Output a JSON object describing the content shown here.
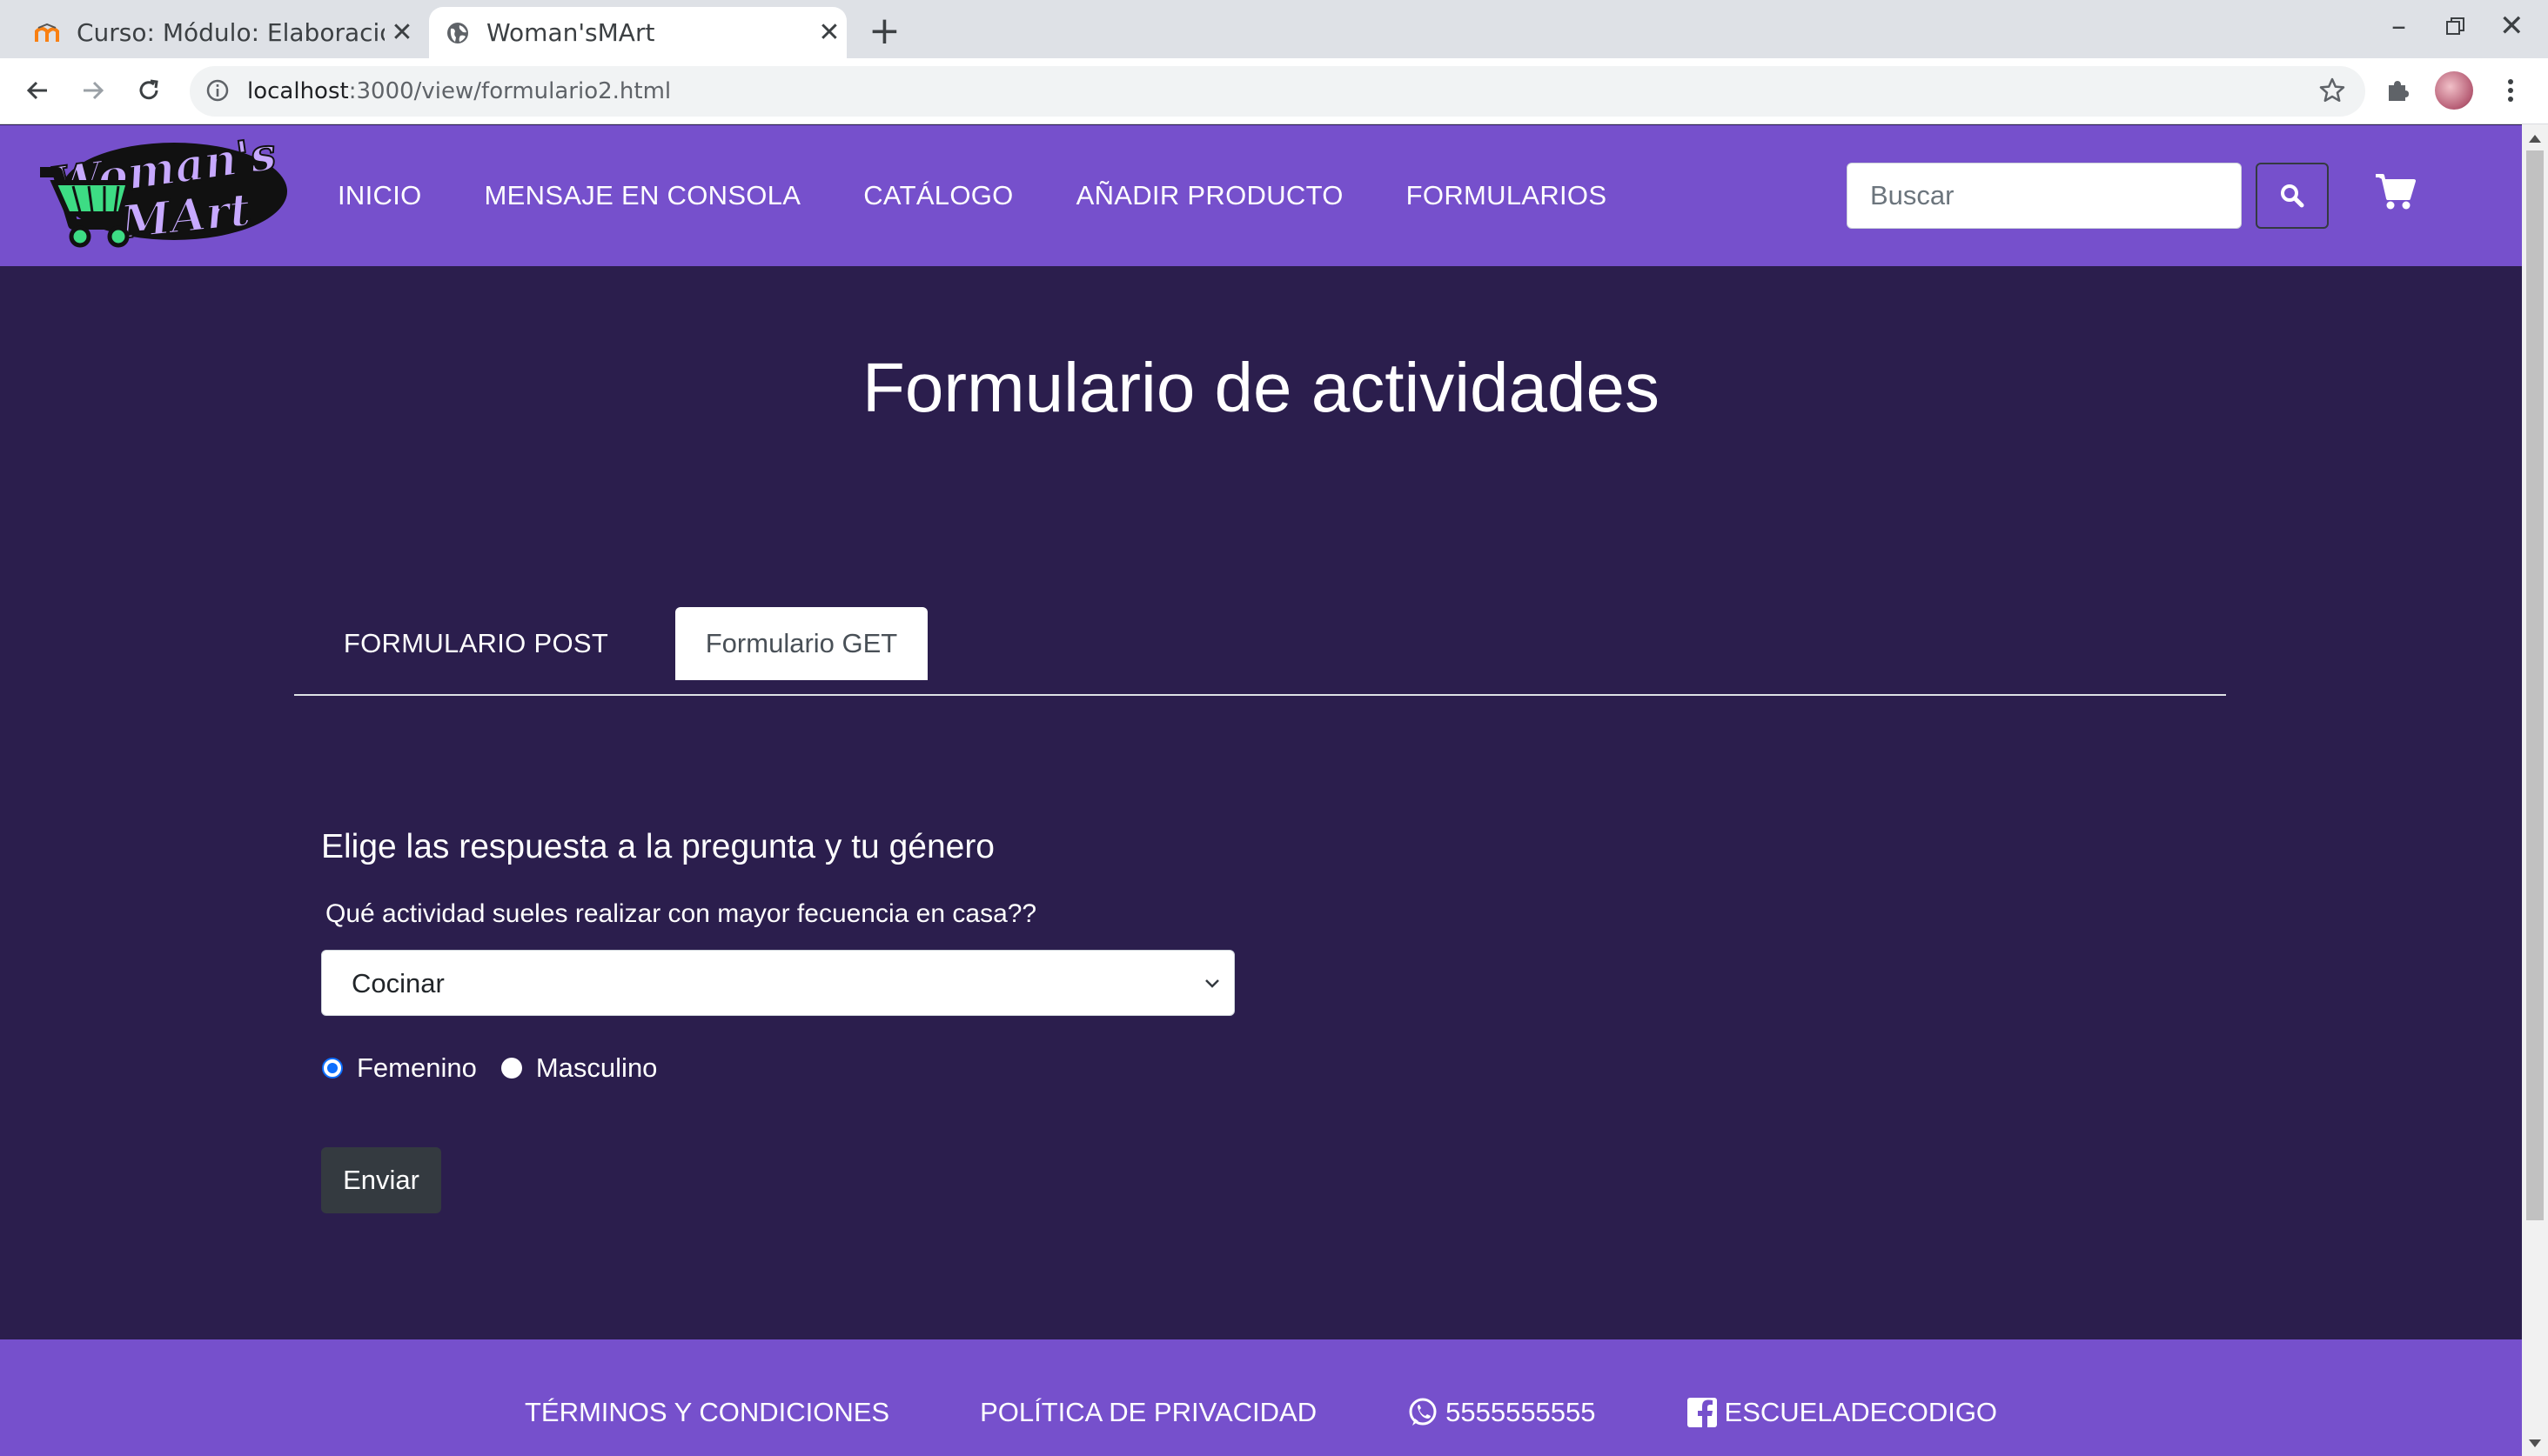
{
  "browser": {
    "tabs": [
      {
        "title": "Curso: Módulo: Elaboración",
        "active": false,
        "icon": "moodle-icon"
      },
      {
        "title": "Woman'sMArt",
        "active": true,
        "icon": "globe-icon"
      }
    ],
    "url_host": "localhost",
    "url_path": ":3000/view/formulario2.html"
  },
  "site": {
    "logo_text": "Woman's MArt",
    "nav": [
      "INICIO",
      "MENSAJE EN CONSOLA",
      "CATÁLOGO",
      "AÑADIR PRODUCTO",
      "FORMULARIOS"
    ],
    "search_placeholder": "Buscar",
    "brand_color": "#7650cc",
    "background_color": "#2b1e4d"
  },
  "main": {
    "title": "Formulario de actividades",
    "tabs": [
      {
        "label": "FORMULARIO POST",
        "active": false
      },
      {
        "label": "Formulario GET",
        "active": true
      }
    ],
    "form": {
      "heading": "Elige las respuesta a la pregunta y tu género",
      "question": "Qué actividad sueles realizar con mayor fecuencia en casa??",
      "selected_activity": "Cocinar",
      "gender_options": [
        {
          "label": "Femenino",
          "checked": true
        },
        {
          "label": "Masculino",
          "checked": false
        }
      ],
      "submit_label": "Enviar"
    }
  },
  "footer": {
    "terms": "TÉRMINOS Y CONDICIONES",
    "privacy": "POLÍTICA DE PRIVACIDAD",
    "whatsapp": "5555555555",
    "facebook": "ESCUELADECODIGO"
  }
}
